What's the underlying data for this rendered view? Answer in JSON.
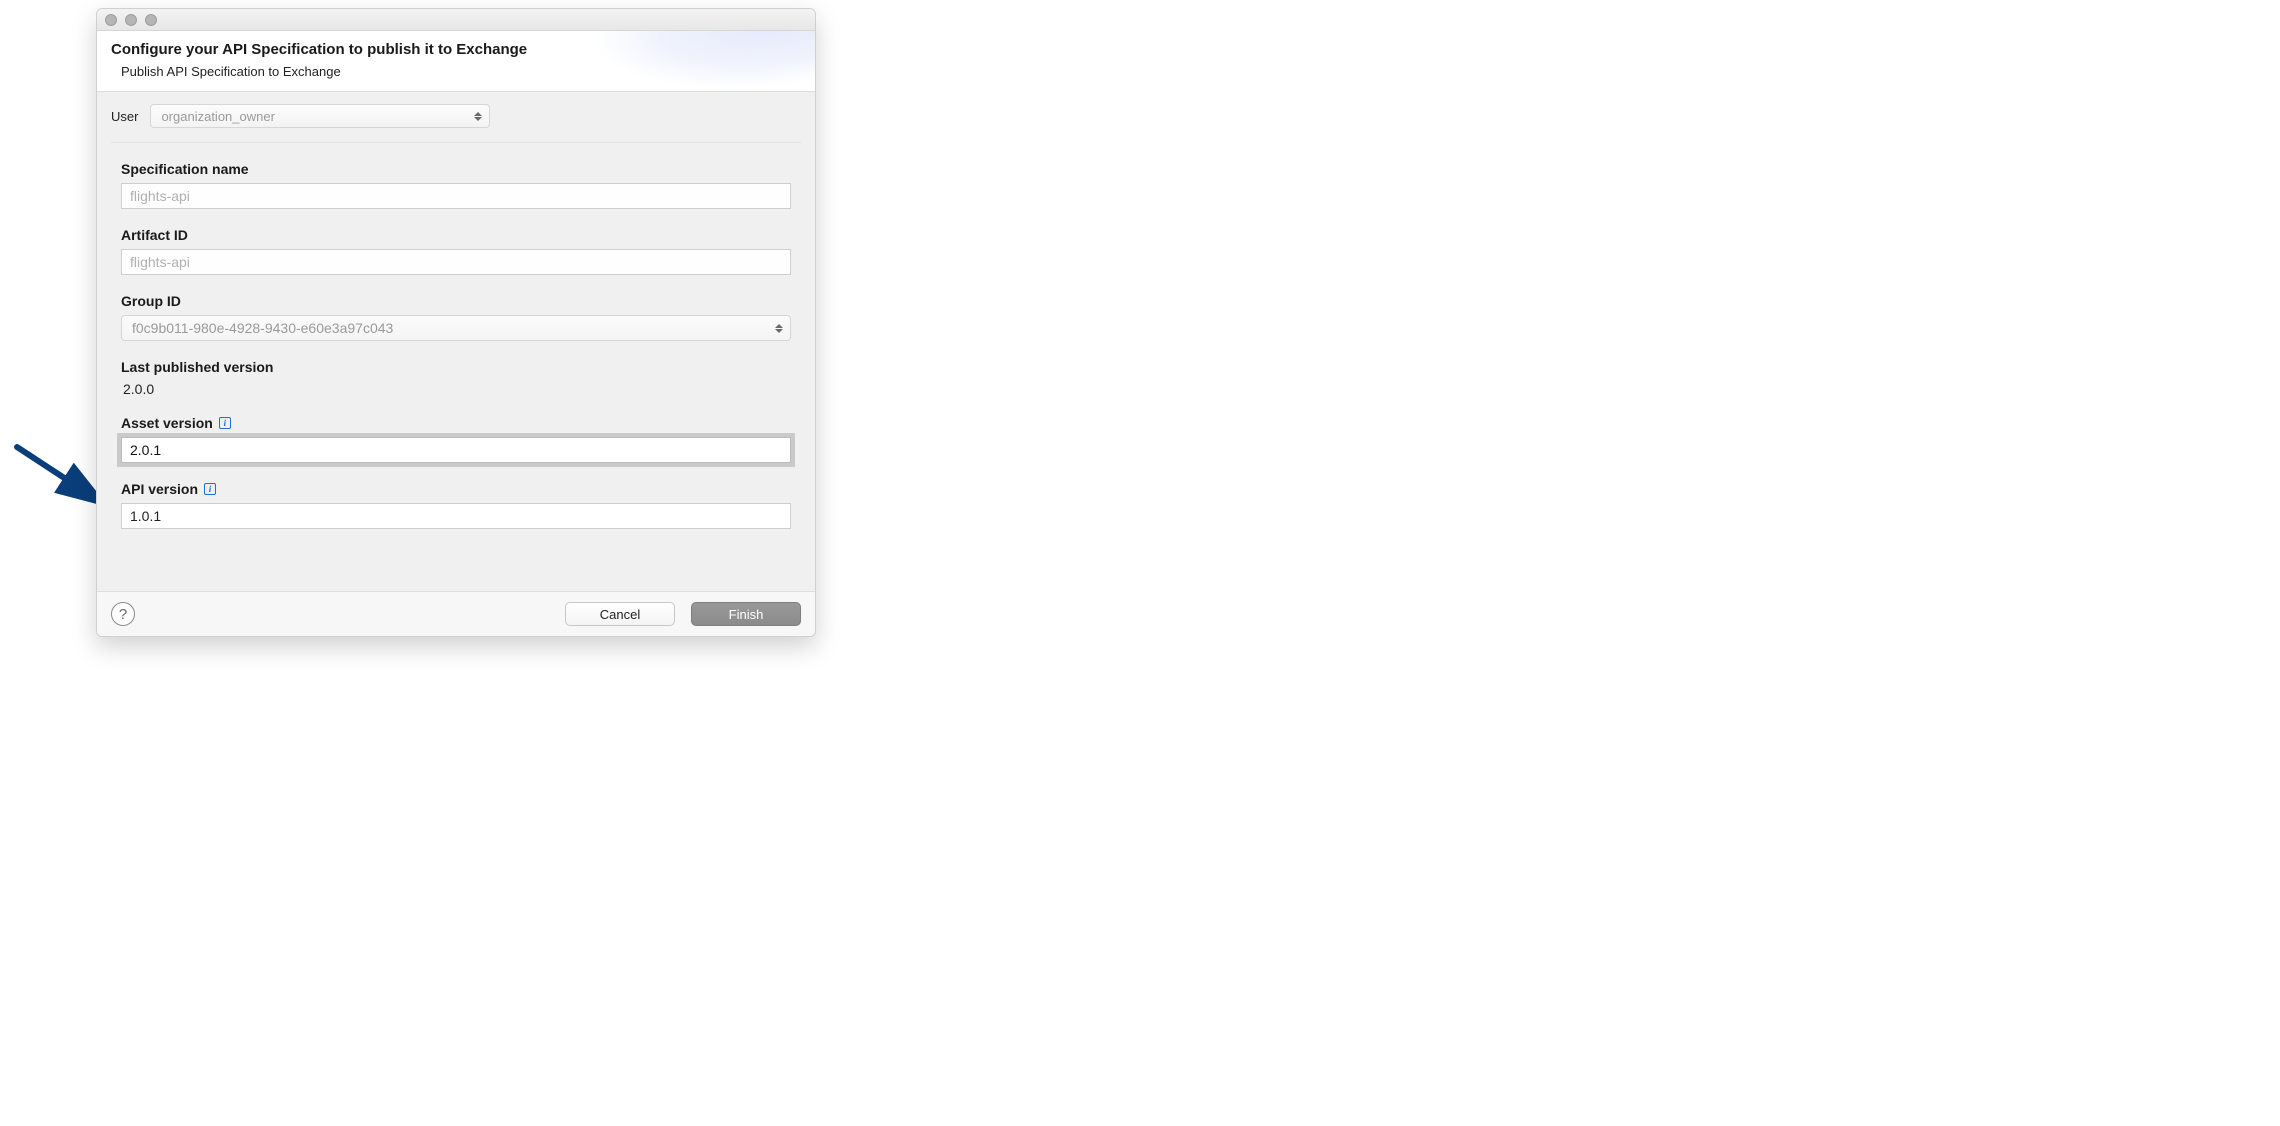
{
  "header": {
    "title": "Configure your API Specification to publish it to Exchange",
    "subtitle": "Publish API Specification to Exchange"
  },
  "user": {
    "label": "User",
    "selected": "organization_owner"
  },
  "fields": {
    "spec_name": {
      "label": "Specification name",
      "value": "flights-api"
    },
    "artifact_id": {
      "label": "Artifact ID",
      "value": "flights-api"
    },
    "group_id": {
      "label": "Group ID",
      "value": "f0c9b011-980e-4928-9430-e60e3a97c043"
    },
    "last_published": {
      "label": "Last published version",
      "value": "2.0.0"
    },
    "asset_version": {
      "label": "Asset version",
      "value": "2.0.1"
    },
    "api_version": {
      "label": "API version",
      "value": "1.0.1"
    }
  },
  "footer": {
    "cancel": "Cancel",
    "finish": "Finish"
  }
}
